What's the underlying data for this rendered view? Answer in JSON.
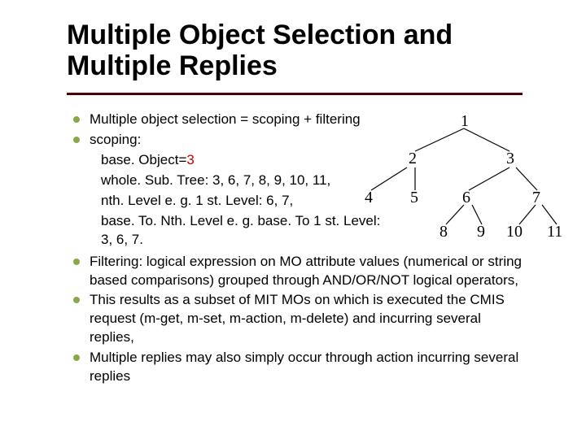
{
  "title": "Multiple Object Selection and Multiple Replies",
  "bullets": {
    "b1": "Multiple object selection = scoping + filtering",
    "b2": "scoping:",
    "sub1_prefix": "base. Object=",
    "sub1_hl": "3",
    "sub2": "whole. Sub. Tree: 3, 6, 7, 8, 9, 10, 11,",
    "sub3": "nth. Level e. g. 1 st. Level: 6, 7,",
    "sub4": "base. To. Nth. Level e. g. base. To 1 st. Level: 3, 6, 7.",
    "b3": "Filtering: logical expression on MO attribute values (numerical or string based comparisons) grouped through AND/OR/NOT logical operators,",
    "b4": "This results as a subset of MIT MOs on which is executed the CMIS request (m-get, m-set, m-action, m-delete) and incurring several replies,",
    "b5": "Multiple replies may also simply occur through action incurring several replies"
  },
  "tree": {
    "n1": "1",
    "n2": "2",
    "n3": "3",
    "n4": "4",
    "n5": "5",
    "n6": "6",
    "n7": "7",
    "n8": "8",
    "n9": "9",
    "n10": "10",
    "n11": "11"
  }
}
